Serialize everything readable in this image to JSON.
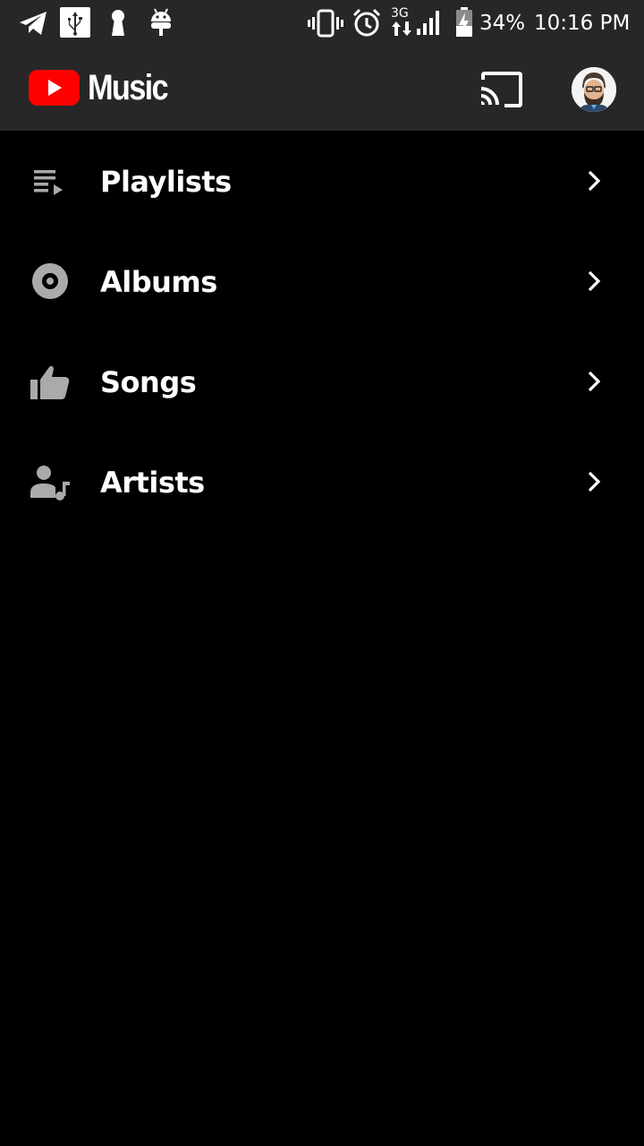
{
  "status_bar": {
    "icons": [
      "telegram-icon",
      "usb-icon",
      "keyhole-icon",
      "android-icon",
      "vibrate-icon",
      "alarm-icon",
      "network-3g-icon",
      "signal-icon",
      "battery-charging-icon"
    ],
    "network_label": "3G",
    "battery": "34%",
    "time": "10:16 PM"
  },
  "app_bar": {
    "logo_text": "Music",
    "brand_color": "#FF0000",
    "icons": [
      "youtube-play-icon",
      "cast-icon",
      "avatar"
    ]
  },
  "library": {
    "items": [
      {
        "label": "Playlists",
        "icon": "playlist-icon"
      },
      {
        "label": "Albums",
        "icon": "album-disc-icon"
      },
      {
        "label": "Songs",
        "icon": "thumb-up-icon"
      },
      {
        "label": "Artists",
        "icon": "artist-music-icon"
      }
    ],
    "chevron_icon": "chevron-right-icon",
    "icon_color": "#AAAAAA"
  }
}
